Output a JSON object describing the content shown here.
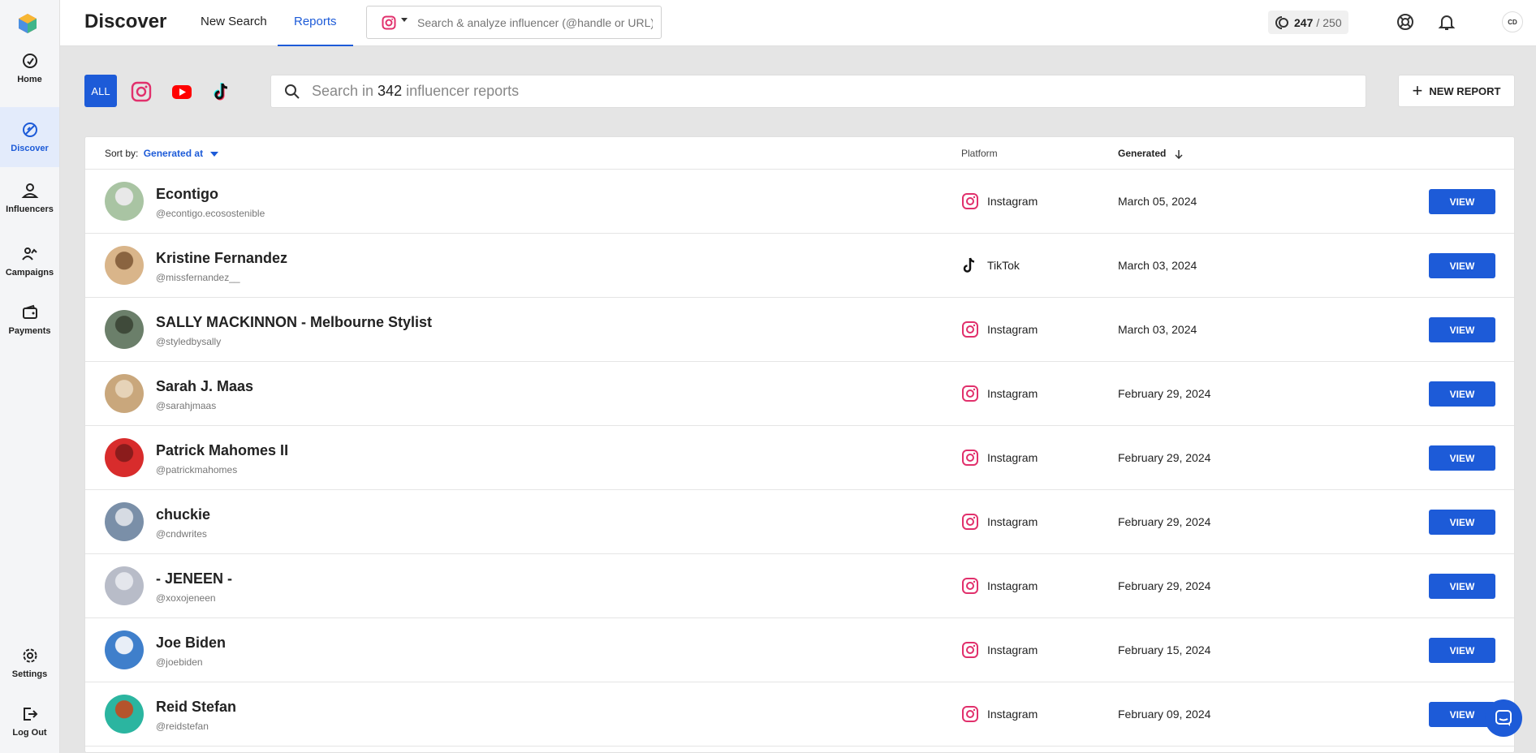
{
  "sidebar": {
    "items": [
      {
        "label": "Home",
        "icon": "home-icon"
      },
      {
        "label": "Discover",
        "icon": "discover-icon"
      },
      {
        "label": "Influencers",
        "icon": "influencers-icon"
      },
      {
        "label": "Campaigns",
        "icon": "campaigns-icon"
      },
      {
        "label": "Payments",
        "icon": "payments-icon"
      },
      {
        "label": "Settings",
        "icon": "settings-icon"
      },
      {
        "label": "Log Out",
        "icon": "logout-icon"
      }
    ],
    "active": "Discover"
  },
  "header": {
    "title": "Discover",
    "tabs": [
      {
        "label": "New Search"
      },
      {
        "label": "Reports"
      }
    ],
    "active_tab": "Reports",
    "search_placeholder": "Search & analyze influencer (@handle or URL)",
    "credits_used": "247",
    "credits_separator": "/",
    "credits_total": "250",
    "user_initials": "CD"
  },
  "filters": {
    "all_label": "ALL",
    "platforms": [
      "instagram-icon",
      "youtube-icon",
      "tiktok-icon"
    ],
    "search_prefix": "Search in",
    "report_count": "342",
    "search_suffix": "influencer reports",
    "new_report_label": "NEW REPORT"
  },
  "table": {
    "sort_label": "Sort by:",
    "sort_value": "Generated at",
    "col_platform": "Platform",
    "col_generated": "Generated",
    "view_label": "VIEW",
    "rows": [
      {
        "name": "Econtigo",
        "handle": "@econtigo.ecosostenible",
        "platform": "Instagram",
        "generated": "March 05, 2024"
      },
      {
        "name": "Kristine Fernandez",
        "handle": "@missfernandez__",
        "platform": "TikTok",
        "generated": "March 03, 2024"
      },
      {
        "name": "SALLY MACKINNON - Melbourne Stylist",
        "handle": "@styledbysally",
        "platform": "Instagram",
        "generated": "March 03, 2024"
      },
      {
        "name": "Sarah J. Maas",
        "handle": "@sarahjmaas",
        "platform": "Instagram",
        "generated": "February 29, 2024"
      },
      {
        "name": "Patrick Mahomes II",
        "handle": "@patrickmahomes",
        "platform": "Instagram",
        "generated": "February 29, 2024"
      },
      {
        "name": "chuckie",
        "handle": "@cndwrites",
        "platform": "Instagram",
        "generated": "February 29, 2024"
      },
      {
        "name": "- JENEEN -",
        "handle": "@xoxojeneen",
        "platform": "Instagram",
        "generated": "February 29, 2024"
      },
      {
        "name": "Joe Biden",
        "handle": "@joebiden",
        "platform": "Instagram",
        "generated": "February 15, 2024"
      },
      {
        "name": "Reid Stefan",
        "handle": "@reidstefan",
        "platform": "Instagram",
        "generated": "February 09, 2024"
      }
    ]
  },
  "colors": {
    "accent": "#1d5bd8",
    "sidebar_active_bg": "#e3ebfb",
    "page_bg": "#e5e5e5"
  }
}
